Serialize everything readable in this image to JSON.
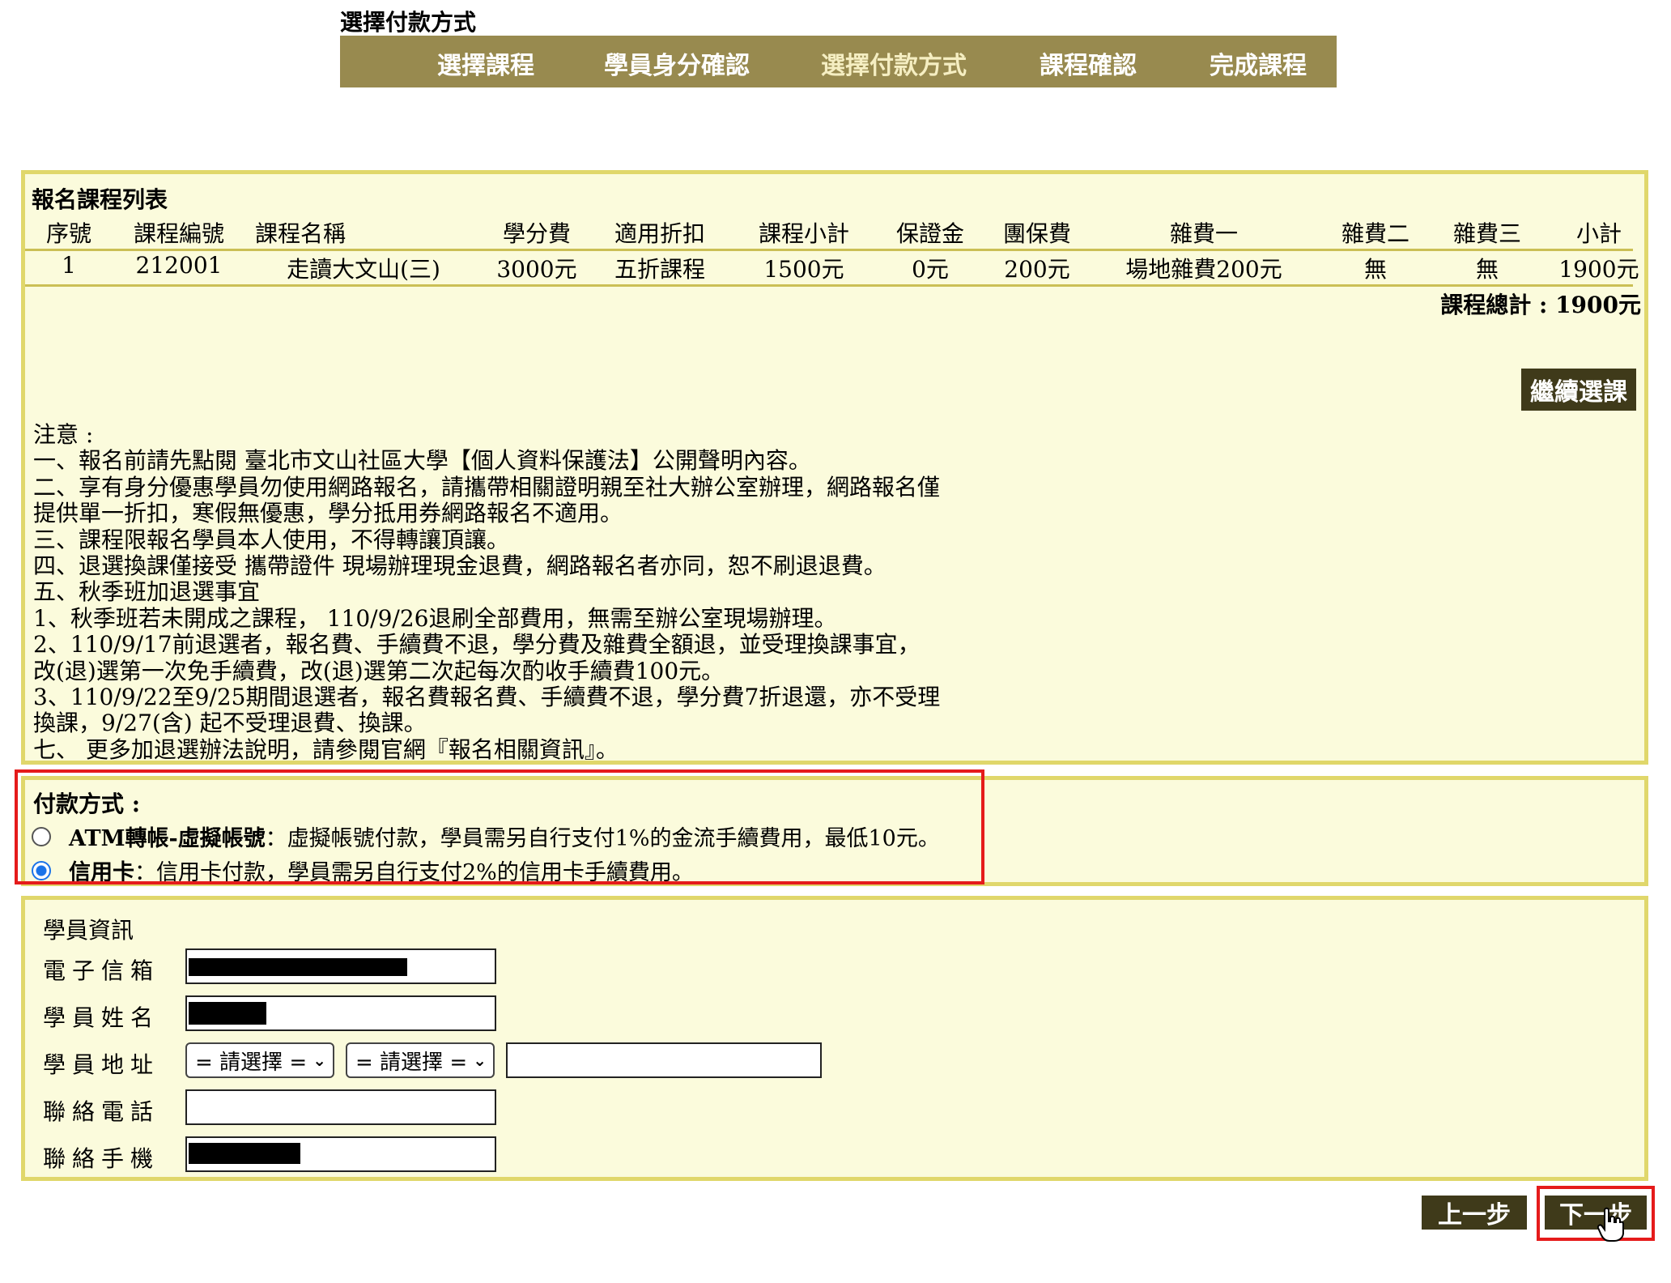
{
  "page_title": "選擇付款方式",
  "steps": [
    "選擇課程",
    "學員身分確認",
    "選擇付款方式",
    "課程確認",
    "完成課程"
  ],
  "course_list": {
    "title": "報名課程列表",
    "headers": [
      "序號",
      "課程編號",
      "課程名稱",
      "學分費",
      "適用折扣",
      "課程小計",
      "保證金",
      "團保費",
      "雜費一",
      "雜費二",
      "雜費三",
      "小計"
    ],
    "row": [
      "1",
      "212001",
      "走讀大文山(三)",
      "3000元",
      "五折課程",
      "1500元",
      "0元",
      "200元",
      "場地雜費200元",
      "無",
      "無",
      "1900元"
    ],
    "total": "課程總計 : 1900元",
    "continue_button": "繼續選課"
  },
  "notes": [
    "注意 :",
    "一、報名前請先點閱 臺北市文山社區大學【個人資料保護法】公開聲明內容。",
    "二、享有身分優惠學員勿使用網路報名，請攜帶相關證明親至社大辦公室辦理，網路報名僅",
    "提供單一折扣，寒假無優惠，學分抵用券網路報名不適用。",
    "三、課程限報名學員本人使用，不得轉讓頂讓。",
    "四、退選換課僅接受 攜帶證件 現場辦理現金退費，網路報名者亦同，恕不刷退退費。",
    "五、秋季班加退選事宜",
    "1、秋季班若未開成之課程， 110/9/26退刷全部費用，無需至辦公室現場辦理。",
    "2、110/9/17前退選者，報名費、手續費不退，學分費及雜費全額退，並受理換課事宜，",
    "改(退)選第一次免手續費，改(退)選第二次起每次酌收手續費100元。",
    "3、110/9/22至9/25期間退選者，報名費報名費、手續費不退，學分費7折退還，亦不受理",
    "換課，9/27(含) 起不受理退費、換課。",
    "七、 更多加退選辦法說明，請參閱官網『報名相關資訊』。"
  ],
  "payment": {
    "title": "付款方式 :",
    "options": [
      {
        "name": "ATM轉帳-虛擬帳號",
        "desc": "：虛擬帳號付款，學員需另自行支付1%的金流手續費用，最低10元。",
        "checked": false
      },
      {
        "name": "信用卡",
        "desc": "：信用卡付款，學員需另自行支付2%的信用卡手續費用。",
        "checked": true
      }
    ]
  },
  "student": {
    "title": "學員資訊",
    "labels": [
      "電子信箱",
      "學員姓名",
      "學員地址",
      "聯絡電話",
      "聯絡手機"
    ],
    "select_placeholder_1": "= 請選擇 =",
    "select_placeholder_2": "= 請選擇 ="
  },
  "nav": {
    "prev": "上一步",
    "next": "下一步"
  },
  "colors": {
    "step_bar": "#988a4f",
    "panel_bg": "#fbfbdc",
    "panel_border": "#e0d76b",
    "button_bg": "#3f3a1a",
    "highlight": "#e51b1b"
  }
}
